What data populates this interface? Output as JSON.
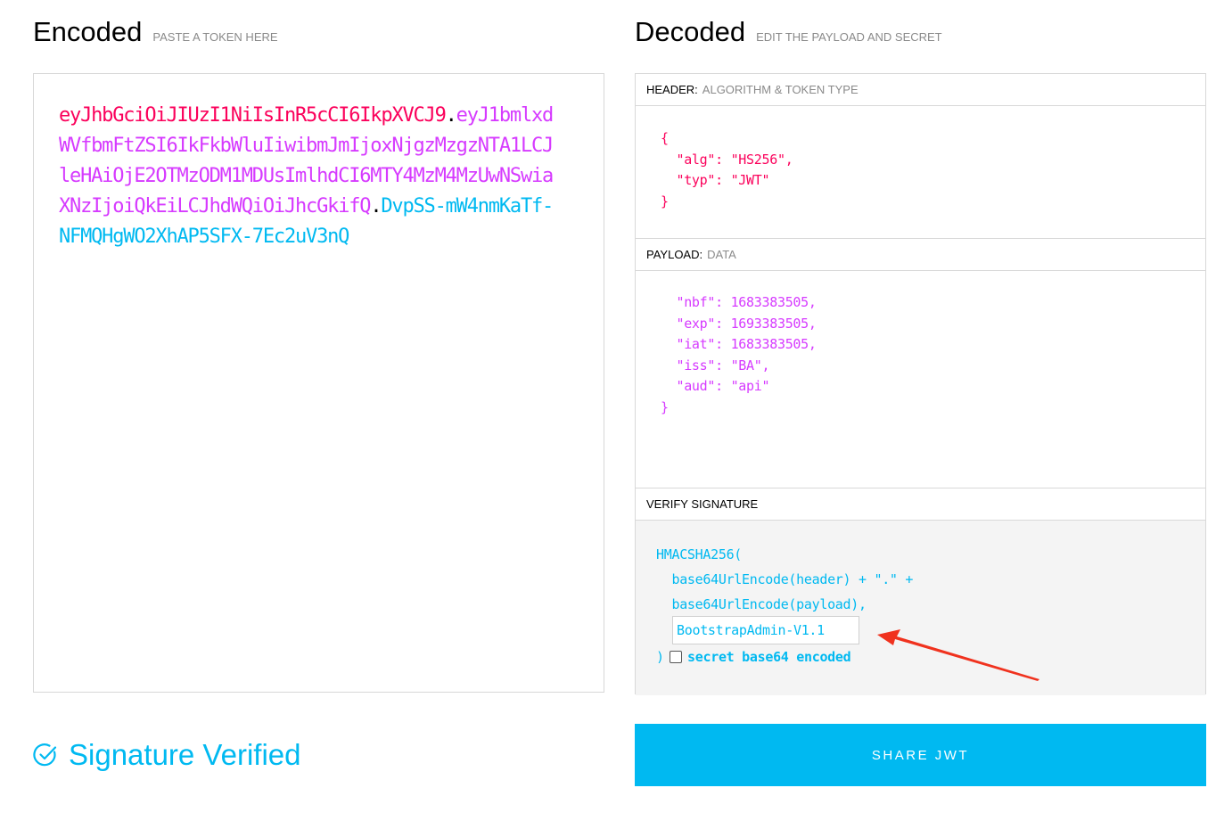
{
  "encoded": {
    "title": "Encoded",
    "subtitle": "PASTE A TOKEN HERE",
    "token_header": "eyJhbGciOiJIUzI1NiIsInR5cCI6IkpXVCJ9",
    "token_payload": "eyJ1bmlxdWVfbmFtZSI6IkFkbWluIiwibmJmIjoxNjgzMzgzNTA1LCJleHAiOjE2OTMzODM1MDUsImlhdCI6MTY4MzM4MzUwNSwiaXNzIjoiQkEiLCJhdWQiOiJhcGkifQ",
    "token_signature": "DvpSS-mW4nmKaTf-NFMQHgWO2XhAP5SFX-7Ec2uV3nQ",
    "dot": "."
  },
  "decoded": {
    "title": "Decoded",
    "subtitle": "EDIT THE PAYLOAD AND SECRET",
    "header": {
      "label": "HEADER:",
      "sublabel": "ALGORITHM & TOKEN TYPE",
      "json": "{\n  \"alg\": \"HS256\",\n  \"typ\": \"JWT\"\n}"
    },
    "payload": {
      "label": "PAYLOAD:",
      "sublabel": "DATA",
      "json": "  \"nbf\": 1683383505,\n  \"exp\": 1693383505,\n  \"iat\": 1683383505,\n  \"iss\": \"BA\",\n  \"aud\": \"api\"\n}"
    },
    "verify": {
      "label": "VERIFY SIGNATURE",
      "line1": "HMACSHA256(",
      "line2": "  base64UrlEncode(header) + \".\" +",
      "line3": "  base64UrlEncode(payload),",
      "secret_value": "BootstrapAdmin-V1.1",
      "close_paren": ")",
      "b64_label": "secret base64 encoded"
    }
  },
  "status": {
    "text": "Signature Verified",
    "icon": "check-circle-icon"
  },
  "share_button": "SHARE JWT",
  "colors": {
    "header": "#fb015b",
    "payload": "#d63aff",
    "signature": "#00b9f1",
    "accent": "#00b9f1",
    "annotation": "#f0321e"
  }
}
